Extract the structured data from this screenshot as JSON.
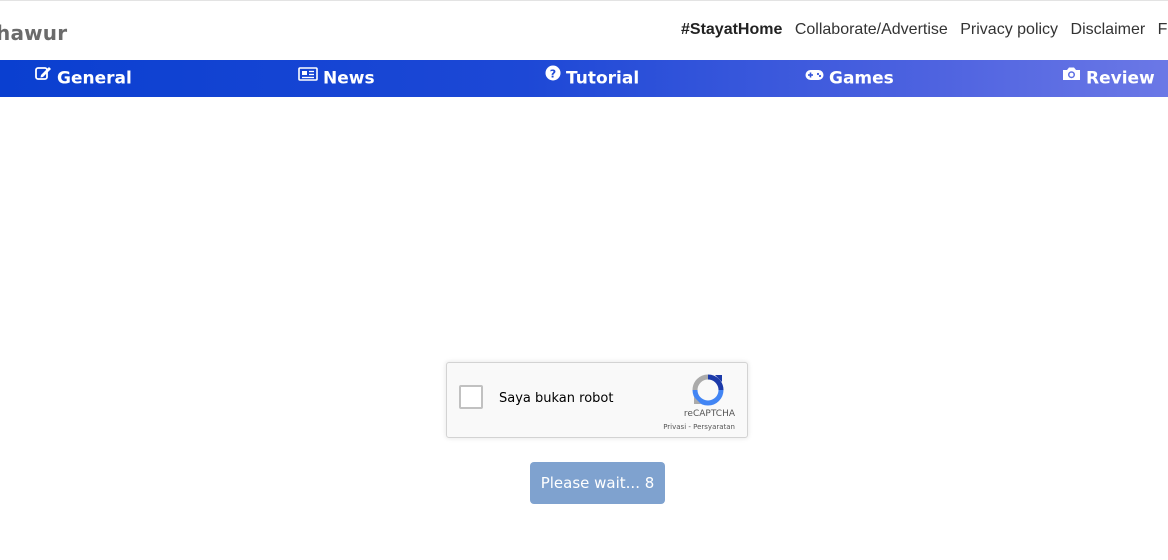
{
  "brand": {
    "text": "hawur"
  },
  "top_links": [
    {
      "label": "#StayatHome"
    },
    {
      "label": "Collaborate/Advertise"
    },
    {
      "label": "Privacy policy"
    },
    {
      "label": "Disclaimer"
    },
    {
      "label": "F"
    }
  ],
  "nav": {
    "items": [
      {
        "label": "General",
        "icon": "edit-icon"
      },
      {
        "label": "News",
        "icon": "newspaper-icon"
      },
      {
        "label": "Tutorial",
        "icon": "question-circle-icon"
      },
      {
        "label": "Games",
        "icon": "gamepad-icon"
      },
      {
        "label": "Review",
        "icon": "camera-icon"
      }
    ]
  },
  "captcha": {
    "label": "Saya bukan robot",
    "brand": "reCAPTCHA",
    "terms": "Privasi - Persyaratan"
  },
  "wait_button": {
    "label": "Please wait... 8"
  },
  "colors": {
    "nav_start": "#0a3fd0",
    "nav_end": "#6b78e6",
    "wait_button": "#7fa2cf"
  }
}
